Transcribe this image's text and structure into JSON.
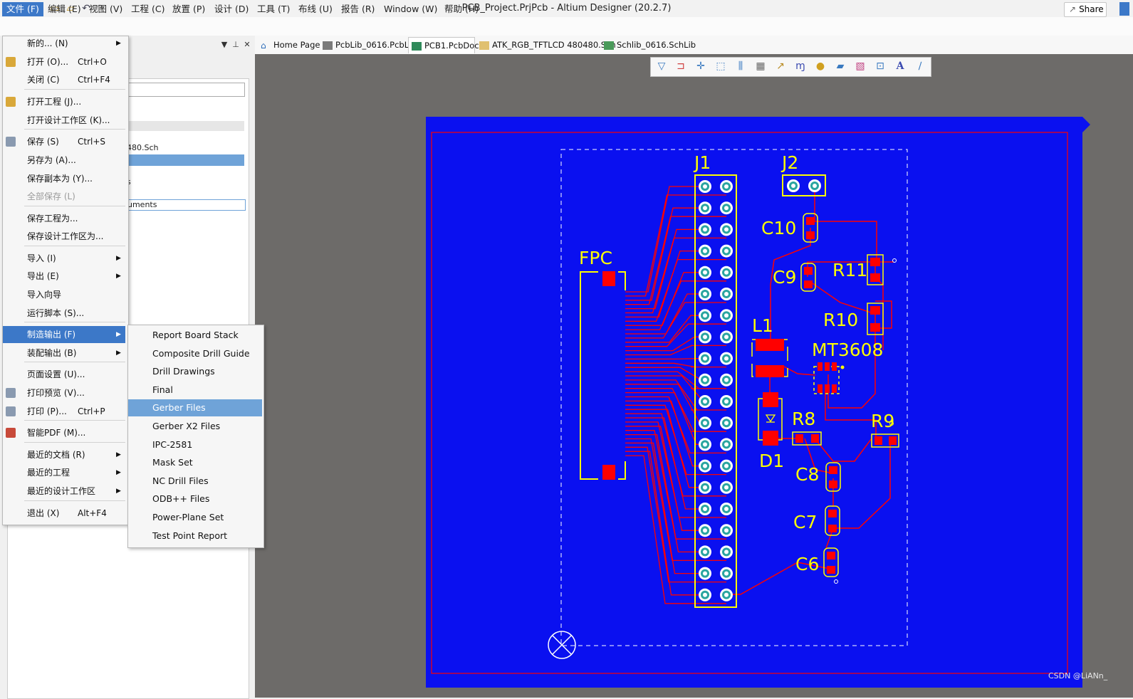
{
  "window": {
    "title": "PCB_Project.PrjPcb - Altium Designer (20.2.7)"
  },
  "menubar": {
    "items": [
      "文件 (F)",
      "编辑 (E)",
      "视图 (V)",
      "工程 (C)",
      "放置 (P)",
      "设计 (D)",
      "工具 (T)",
      "布线 (U)",
      "报告 (R)",
      "Window (W)",
      "帮助 (H)"
    ],
    "share_label": "Share"
  },
  "tabs": [
    {
      "label": "Home Page",
      "icon": "home-icon"
    },
    {
      "label": "PcbLib_0616.PcbLib",
      "icon": "pcblib-icon"
    },
    {
      "label": "PCB1.PcbDoc",
      "icon": "pcbdoc-icon",
      "active": true
    },
    {
      "label": "ATK_RGB_TFTLCD 480480.Sch",
      "icon": "schematic-icon"
    },
    {
      "label": "Schlib_0616.SchLib",
      "icon": "schlib-icon"
    }
  ],
  "panel": {
    "rows": [
      "480.Sch",
      "s",
      "uments"
    ]
  },
  "file_menu": {
    "items": [
      {
        "label": "新的... (N)",
        "shortcut": "",
        "submenu": true
      },
      {
        "label": "打开 (O)...",
        "shortcut": "Ctrl+O",
        "icon": "open-folder-icon"
      },
      {
        "label": "关闭 (C)",
        "shortcut": "Ctrl+F4"
      },
      {
        "label": "打开工程 (J)...",
        "shortcut": "",
        "icon": "open-project-icon"
      },
      {
        "label": "打开设计工作区 (K)...",
        "shortcut": ""
      },
      {
        "label": "保存 (S)",
        "shortcut": "Ctrl+S",
        "icon": "save-icon"
      },
      {
        "label": "另存为 (A)...",
        "shortcut": ""
      },
      {
        "label": "保存副本为 (Y)...",
        "shortcut": ""
      },
      {
        "label": "全部保存 (L)",
        "shortcut": "",
        "disabled": true
      },
      {
        "label": "保存工程为...",
        "shortcut": ""
      },
      {
        "label": "保存设计工作区为...",
        "shortcut": ""
      },
      {
        "label": "导入 (I)",
        "shortcut": "",
        "submenu": true
      },
      {
        "label": "导出 (E)",
        "shortcut": "",
        "submenu": true
      },
      {
        "label": "导入向导",
        "shortcut": ""
      },
      {
        "label": "运行脚本 (S)...",
        "shortcut": ""
      },
      {
        "label": "制造输出 (F)",
        "shortcut": "",
        "submenu": true,
        "highlighted": true
      },
      {
        "label": "装配输出 (B)",
        "shortcut": "",
        "submenu": true
      },
      {
        "label": "页面设置 (U)...",
        "shortcut": ""
      },
      {
        "label": "打印预览 (V)...",
        "shortcut": "",
        "icon": "print-preview-icon"
      },
      {
        "label": "打印 (P)...",
        "shortcut": "Ctrl+P",
        "icon": "print-icon"
      },
      {
        "label": "智能PDF (M)...",
        "shortcut": "",
        "icon": "smart-pdf-icon"
      },
      {
        "label": "最近的文档 (R)",
        "shortcut": "",
        "submenu": true
      },
      {
        "label": "最近的工程",
        "shortcut": "",
        "submenu": true
      },
      {
        "label": "最近的设计工作区",
        "shortcut": "",
        "submenu": true
      },
      {
        "label": "退出 (X)",
        "shortcut": "Alt+F4"
      }
    ]
  },
  "fabrication_submenu": {
    "items": [
      {
        "label": "Report Board Stack"
      },
      {
        "label": "Composite Drill Guide"
      },
      {
        "label": "Drill Drawings"
      },
      {
        "label": "Final"
      },
      {
        "label": "Gerber Files",
        "highlighted": true
      },
      {
        "label": "Gerber X2 Files"
      },
      {
        "label": "IPC-2581"
      },
      {
        "label": "Mask Set"
      },
      {
        "label": "NC Drill Files"
      },
      {
        "label": "ODB++ Files"
      },
      {
        "label": "Power-Plane Set"
      },
      {
        "label": "Test Point Report"
      }
    ]
  },
  "pcb": {
    "designators": {
      "j1": "J1",
      "j2": "J2",
      "fpc": "FPC",
      "c10": "C10",
      "c9": "C9",
      "r11": "R11",
      "r10": "R10",
      "l1": "L1",
      "mt3608": "MT3608",
      "r8": "R8",
      "r9": "R9",
      "d1": "D1",
      "c8": "C8",
      "c7": "C7",
      "c6": "C6"
    },
    "colors": {
      "workspace": "#6d6b69",
      "board": "#0a10f0",
      "copper": "#ff0000",
      "overlay": "#ffff00",
      "pad_hole": "#2aa5a0"
    }
  },
  "watermark": "CSDN @LiANn_"
}
